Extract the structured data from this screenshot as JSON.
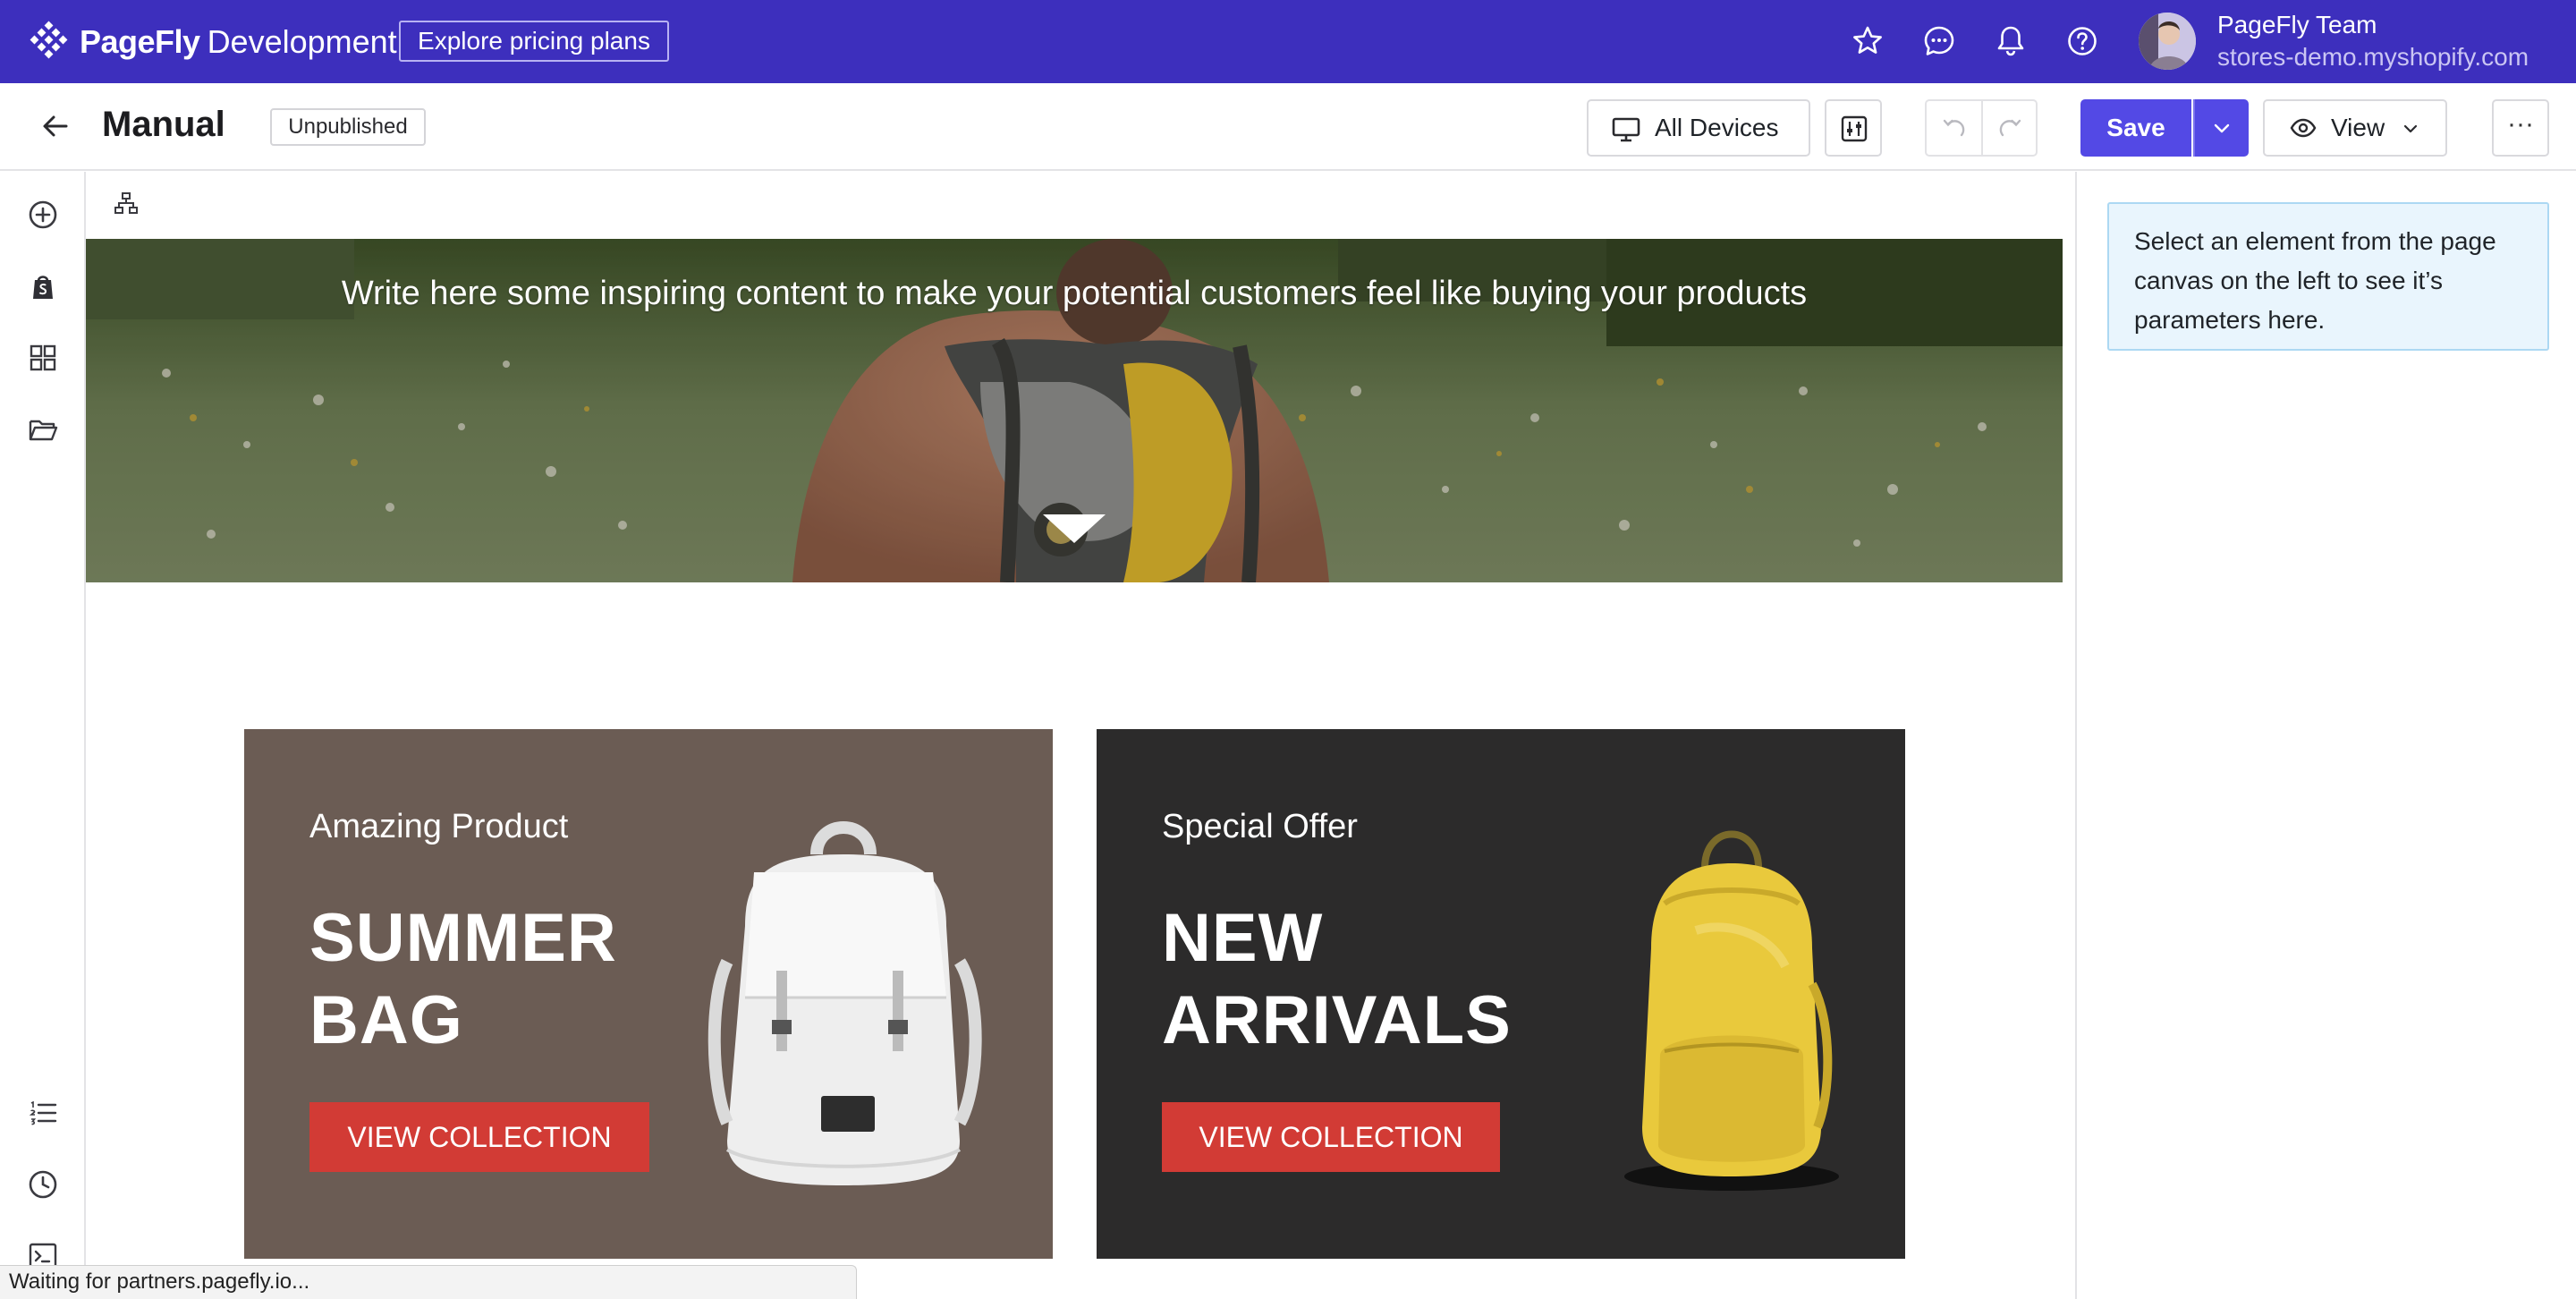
{
  "topbar": {
    "brand_name": "PageFly",
    "brand_suffix": "Development",
    "pricing_label": "Explore pricing plans",
    "icons": [
      "star-icon",
      "chat-icon",
      "bell-icon",
      "help-icon"
    ],
    "user": {
      "name": "PageFly Team",
      "store": "stores-demo.myshopify.com"
    },
    "color": "#3d2fbd"
  },
  "toolbar": {
    "title": "Manual",
    "status": "Unpublished",
    "devices_label": "All Devices",
    "save_label": "Save",
    "view_label": "View",
    "more_label": "···",
    "accent": "#5349e5"
  },
  "sidebar": {
    "icons": [
      "add-element-icon",
      "shopify-icon",
      "templates-grid-icon",
      "folder-icon",
      "layers-list-icon",
      "history-icon",
      "code-icon"
    ]
  },
  "canvas": {
    "hero_text": "Write here some inspiring content to make your potential customers feel like buying your products",
    "promos": [
      {
        "eyebrow": "Amazing Product",
        "headline_line1": "SUMMER",
        "headline_line2": "BAG",
        "cta": "VIEW COLLECTION",
        "color": "#6b5c54"
      },
      {
        "eyebrow": "Special Offer",
        "headline_line1": "NEW",
        "headline_line2": "ARRIVALS",
        "cta": "VIEW COLLECTION",
        "color": "#2c2b2b"
      }
    ],
    "cta_color": "#d23b35"
  },
  "right_panel": {
    "hint": "Select an element from the page canvas on the left to see it’s parameters here."
  },
  "statusbar": {
    "text": "Waiting for partners.pagefly.io..."
  }
}
